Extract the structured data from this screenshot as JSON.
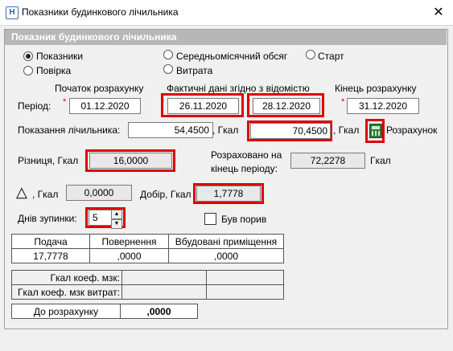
{
  "window": {
    "title": "Показники будинкового лічильника",
    "app_icon": "Н",
    "close_glyph": "✕"
  },
  "panel": {
    "title": "Показник будинкового лічильника"
  },
  "modes": [
    {
      "label": "Показники",
      "checked": true
    },
    {
      "label": "Повірка",
      "checked": false
    },
    {
      "label": "Середньомісячний обсяг",
      "checked": false
    },
    {
      "label": "Старт",
      "checked": false
    },
    {
      "label": "Витрата",
      "checked": false
    }
  ],
  "period": {
    "label": "Період:",
    "start_header": "Початок розрахунку",
    "actual_header": "Фактичні дані згідно з відомістю",
    "end_header": "Кінець розрахунку",
    "start_date": "01.12.2020",
    "actual_from": "26.11.2020",
    "actual_to": "28.12.2020",
    "end_date": "31.12.2020",
    "required_mark": "*"
  },
  "readings": {
    "label": "Показання лічильника:",
    "start_value": "54,4500",
    "unit1": ", Гкал",
    "end_value": "70,4500",
    "unit2": ", Гкал",
    "calc_button_label": "Розрахунок"
  },
  "difference": {
    "label": "Різниця, Гкал",
    "value": "16,0000"
  },
  "calculated": {
    "label_line1": "Розраховано на",
    "label_line2": "кінець періоду:",
    "value": "72,2278",
    "unit": "Гкал"
  },
  "delta": {
    "symbol": "△",
    "label": ", Гкал",
    "value": "0,0000"
  },
  "addition": {
    "label": "Добір, Гкал",
    "value": "1,7778"
  },
  "stop_days": {
    "label": "Днів зупинки:",
    "value": "5",
    "up": "▲",
    "down": "▼"
  },
  "breakthrough": {
    "label": "Був порив",
    "checked": false
  },
  "supply_table": {
    "headers": [
      "Подача",
      "Повернення",
      "Вбудовані приміщення"
    ],
    "values": [
      "17,7778",
      ",0000",
      ",0000"
    ]
  },
  "coef_table": {
    "rows": [
      {
        "label": "Гкал коеф. мзк:",
        "cells": [
          "",
          ""
        ]
      },
      {
        "label": "Гкал коеф. мзк витрат:",
        "cells": [
          "",
          ""
        ]
      }
    ]
  },
  "to_calc": {
    "label": "До розрахунку",
    "value": ",0000"
  }
}
